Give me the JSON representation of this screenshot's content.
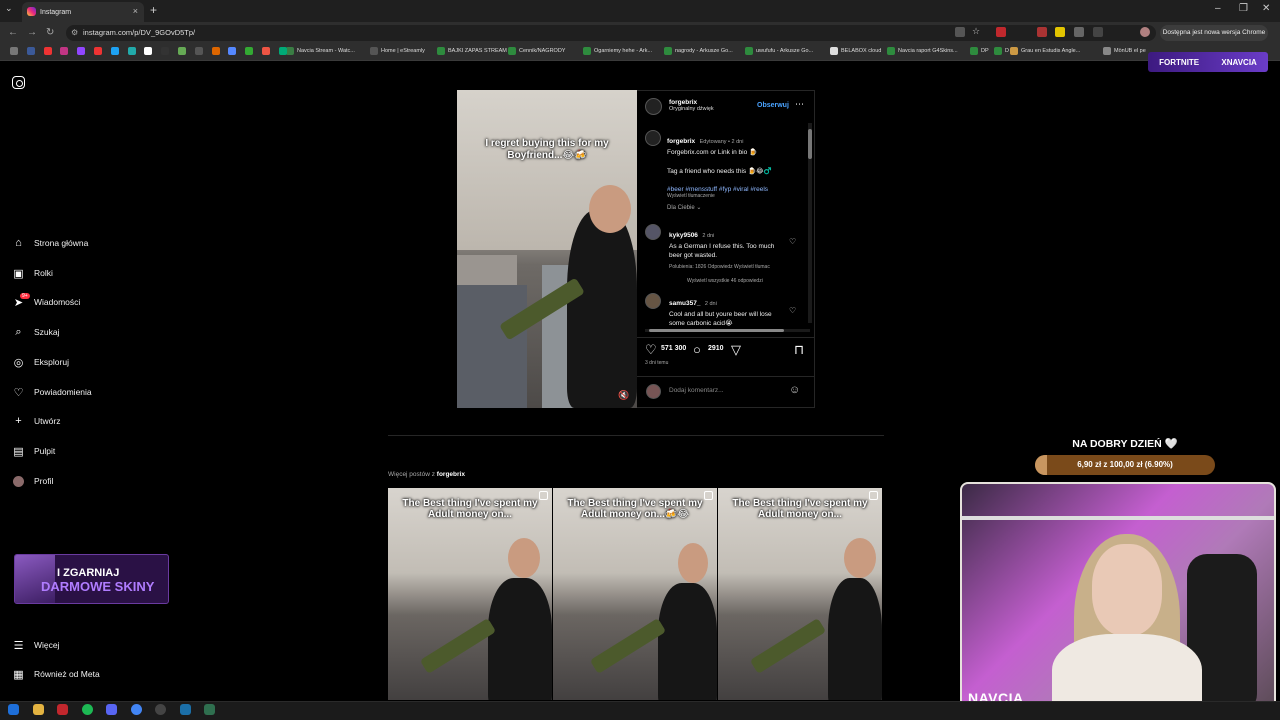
{
  "browser": {
    "tab_title": "Instagram",
    "url": "instagram.com/p/DV_9GOvD5Tp/",
    "update_button": "Dostępna jest nowa wersja Chrome",
    "bookmarks": [
      "Navcia Stream - Watc...",
      "Home | eStreamly",
      "BAJKI ZAPAS STREAM",
      "Cennik/NAGRODY",
      "Ogarniemy hehe - Ark...",
      "nagrody - Arkusze Go...",
      "uwufufu - Arkusze Go...",
      "BELABOX cloud",
      "Navcia raport G4Skins...",
      "DP",
      "D",
      "Grau en Estudis Angle...",
      "MönUB el pe"
    ]
  },
  "sidebar": {
    "items": [
      {
        "label": "Strona główna",
        "icon": "home-icon"
      },
      {
        "label": "Rolki",
        "icon": "reels-icon"
      },
      {
        "label": "Wiadomości",
        "icon": "messages-icon",
        "badge": "9+"
      },
      {
        "label": "Szukaj",
        "icon": "search-icon"
      },
      {
        "label": "Eksploruj",
        "icon": "compass-icon"
      },
      {
        "label": "Powiadomienia",
        "icon": "heart-icon"
      },
      {
        "label": "Utwórz",
        "icon": "plus-icon"
      },
      {
        "label": "Pulpit",
        "icon": "dashboard-icon"
      },
      {
        "label": "Profil",
        "icon": "avatar-icon"
      }
    ],
    "more": "Więcej",
    "meta": "Również od Meta"
  },
  "promo": {
    "line1": "I ZGARNIAJ",
    "line2": "DARMOWE SKINY"
  },
  "post": {
    "video_caption": "I regret buying this for my Boyfriend...😂🍻",
    "author": "forgebrix",
    "audio": "Oryginalny dźwięk",
    "follow": "Obserwuj",
    "caption_meta": "Edytowany • 2 dni",
    "caption_line1": "Forgebrix.com or Link in bio 🍺",
    "caption_line2": "Tag a friend who needs this 🍺😂♂️",
    "hashtags": "#beer #mensstuff #fyp #viral #reels",
    "see_translation": "Wyświetl tłumaczenie",
    "for_you": "Dla Ciebie",
    "comments": [
      {
        "user": "kyky9506",
        "time": "2 dni",
        "text": "As a German I refuse this. Too much beer got wasted.",
        "meta": "Polubienia: 1826   Odpowiedz   Wyświetl tłumac",
        "replies": "Wyświetl wszystkie 46 odpowiedzi"
      },
      {
        "user": "samu357_",
        "time": "2 dni",
        "text": "Cool and all but youre beer will lose some carbonic acid😭"
      }
    ],
    "likes": "571 300",
    "comment_count": "2910",
    "posted": "3 dni temu",
    "add_comment": "Dodaj komentarz..."
  },
  "more_posts": {
    "label": "Więcej postów z",
    "user": "forgebrix",
    "thumbs": [
      "The Best thing I've spent my Adult money on...",
      "The Best thing I've spent my Adult money on...🍻😂",
      "The Best thing I've spent my Adult money on..."
    ]
  },
  "overlay": {
    "fortnite": "FORTNITE",
    "fortnite_user": "XNAVCIA",
    "goal_title": "NA DOBRY DZIEŃ 🤍",
    "goal_text": "6,90 zł z 100,00 zł (6.90%)",
    "goal_fraction": 0.069,
    "cam_name": "NAVCIA"
  }
}
